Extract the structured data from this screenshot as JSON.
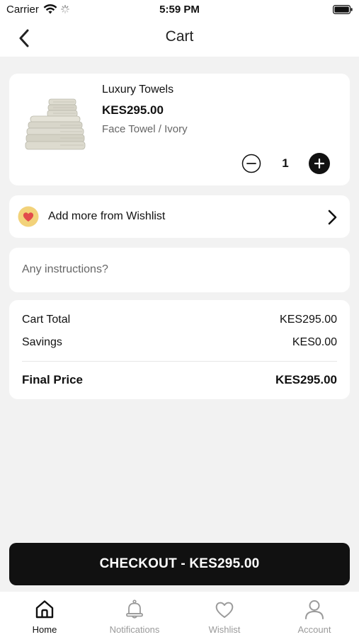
{
  "status_bar": {
    "carrier": "Carrier",
    "time": "5:59 PM"
  },
  "header": {
    "title": "Cart",
    "back_icon": "chevron-left-icon"
  },
  "cart_item": {
    "name": "Luxury Towels",
    "price": "KES295.00",
    "variant": "Face Towel / Ivory",
    "quantity": "1",
    "image": "towel-stack-image"
  },
  "wishlist_link": {
    "label": "Add more from Wishlist",
    "icon": "heart-icon",
    "icon_bg": "#f2d27a",
    "icon_color": "#e24b4b"
  },
  "instructions": {
    "placeholder": "Any instructions?",
    "value": ""
  },
  "totals": {
    "cart_total_label": "Cart Total",
    "cart_total_value": "KES295.00",
    "savings_label": "Savings",
    "savings_value": "KES0.00",
    "final_label": "Final Price",
    "final_value": "KES295.00"
  },
  "checkout": {
    "label": "CHECKOUT - KES295.00"
  },
  "tabbar": {
    "active": "Home",
    "tabs": [
      {
        "label": "Home",
        "icon": "home-icon"
      },
      {
        "label": "Notifications",
        "icon": "bell-icon"
      },
      {
        "label": "Wishlist",
        "icon": "heart-outline-icon"
      },
      {
        "label": "Account",
        "icon": "person-icon"
      }
    ]
  },
  "colors": {
    "background": "#f2f2f2",
    "card": "#ffffff",
    "primary": "#111111",
    "muted": "#9a9a9a"
  }
}
